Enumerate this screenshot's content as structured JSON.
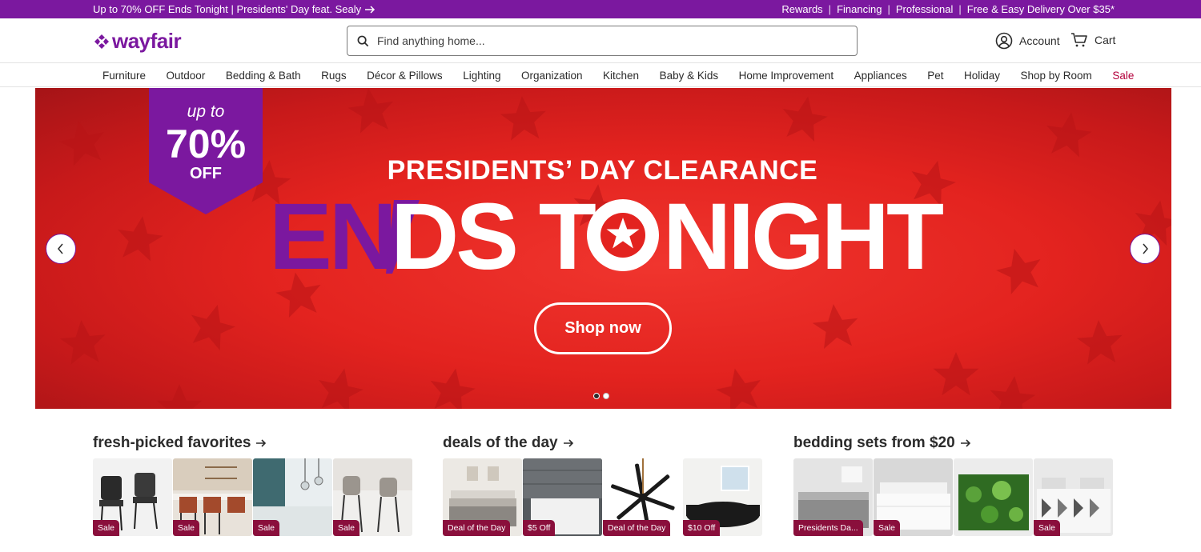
{
  "promo": {
    "left_text": "Up to 70% OFF Ends Tonight | Presidents' Day feat. Sealy",
    "right_links": [
      "Rewards",
      "Financing",
      "Professional",
      "Free & Easy Delivery Over $35*"
    ],
    "separator": "|"
  },
  "header": {
    "logo": "wayfair",
    "search_placeholder": "Find anything home...",
    "account_label": "Account",
    "cart_label": "Cart"
  },
  "nav": {
    "items": [
      "Furniture",
      "Outdoor",
      "Bedding & Bath",
      "Rugs",
      "Décor & Pillows",
      "Lighting",
      "Organization",
      "Kitchen",
      "Baby & Kids",
      "Home Improvement",
      "Appliances",
      "Pet",
      "Holiday",
      "Shop by Room"
    ],
    "sale_label": "Sale"
  },
  "hero": {
    "badge_upto": "up to",
    "badge_pct": "70%",
    "badge_off": "OFF",
    "subtitle": "PRESIDENTS’ DAY CLEARANCE",
    "headline_part1": "EN",
    "headline_part2": "DS T",
    "headline_part3": "NIGHT",
    "cta": "Shop now",
    "slide_count": 2,
    "active_slide": 1
  },
  "sections": [
    {
      "title": "fresh-picked favorites",
      "tiles": [
        {
          "tag": "Sale",
          "image": "black leather counter stools"
        },
        {
          "tag": "Sale",
          "image": "brown stools at kitchen counter"
        },
        {
          "tag": "Sale",
          "image": "teal kitchen with pendant lights"
        },
        {
          "tag": "Sale",
          "image": "gray bar stools"
        }
      ]
    },
    {
      "title": "deals of the day",
      "tiles": [
        {
          "tag": "Deal of the Day",
          "image": "bedroom with gray bedding"
        },
        {
          "tag": "$5 Off",
          "image": "shower base"
        },
        {
          "tag": "Deal of the Day",
          "image": "ceiling fan"
        },
        {
          "tag": "$10 Off",
          "image": "black bathtub"
        }
      ]
    },
    {
      "title": "bedding sets from $20",
      "tiles": [
        {
          "tag": "Presidents Da...",
          "image": "gray comforter set"
        },
        {
          "tag": "Sale",
          "image": "white bedding set"
        },
        {
          "tag": "",
          "image": "green floral bedding"
        },
        {
          "tag": "Sale",
          "image": "geometric bedding set"
        }
      ]
    }
  ],
  "colors": {
    "brand_purple": "#7b189f",
    "sale_red": "#b4003c",
    "hero_red": "#e3231f",
    "tag_bg": "#8a0f3c"
  }
}
